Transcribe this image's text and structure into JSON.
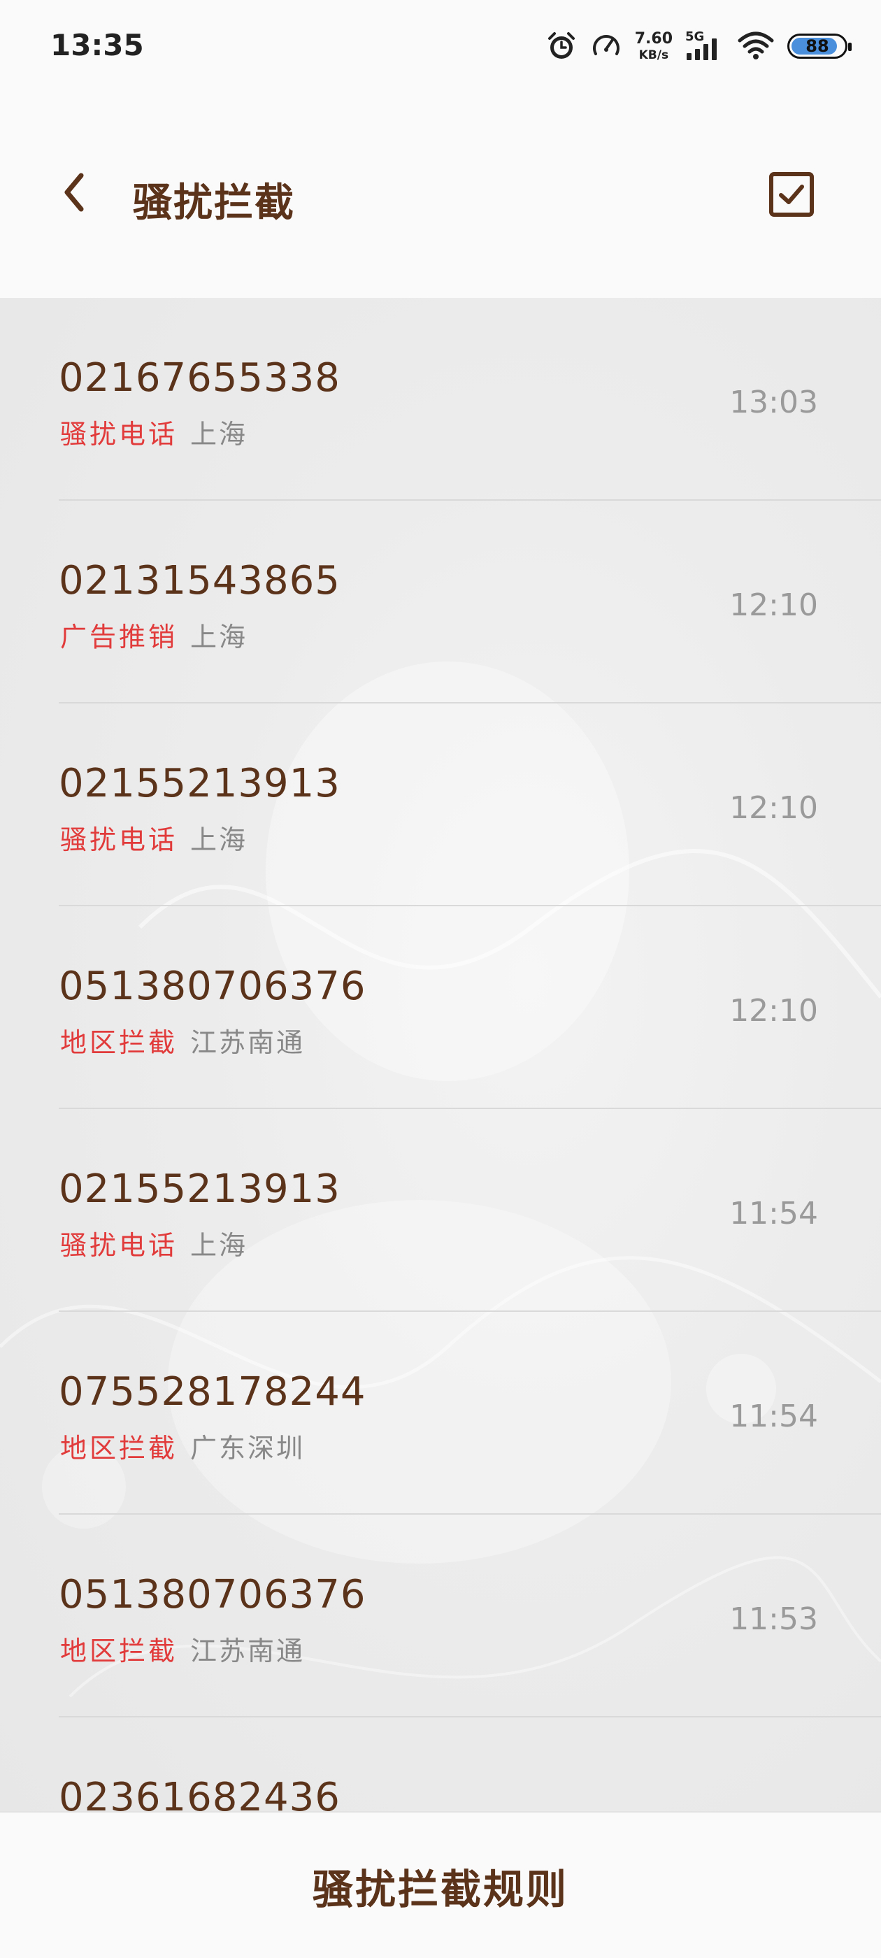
{
  "status_bar": {
    "time": "13:35",
    "net_speed_value": "7.60",
    "net_speed_unit": "KB/s",
    "network_type": "5G",
    "battery_level": "88",
    "battery_fill_fraction": 0.88,
    "icons": [
      "alarm-icon",
      "speedometer-icon",
      "signal-icon",
      "wifi-icon",
      "battery-icon"
    ]
  },
  "header": {
    "title": "骚扰拦截",
    "back_icon": "chevron-left-icon",
    "select_icon": "checkbox-icon"
  },
  "list": {
    "items": [
      {
        "number": "02167655338",
        "tag": "骚扰电话",
        "location": "上海",
        "time": "13:03"
      },
      {
        "number": "02131543865",
        "tag": "广告推销",
        "location": "上海",
        "time": "12:10"
      },
      {
        "number": "02155213913",
        "tag": "骚扰电话",
        "location": "上海",
        "time": "12:10"
      },
      {
        "number": "051380706376",
        "tag": "地区拦截",
        "location": "江苏南通",
        "time": "12:10"
      },
      {
        "number": "02155213913",
        "tag": "骚扰电话",
        "location": "上海",
        "time": "11:54"
      },
      {
        "number": "075528178244",
        "tag": "地区拦截",
        "location": "广东深圳",
        "time": "11:54"
      },
      {
        "number": "051380706376",
        "tag": "地区拦截",
        "location": "江苏南通",
        "time": "11:53"
      },
      {
        "number": "02361682436",
        "tag": "",
        "location": "",
        "time": ""
      }
    ]
  },
  "bottom": {
    "rules_label": "骚扰拦截规则"
  },
  "colors": {
    "accent_brown": "#5b321a",
    "tag_red": "#e23b3b",
    "secondary_gray": "#888888",
    "battery_blue": "#4a8fdc"
  }
}
